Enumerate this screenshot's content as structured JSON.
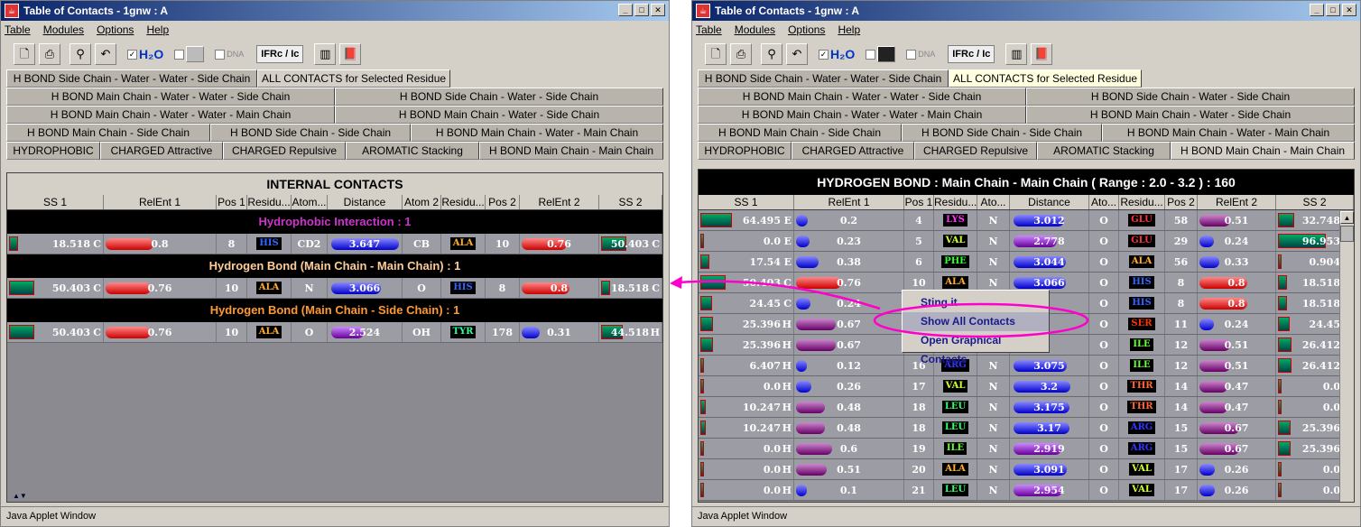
{
  "window_title": "Table of Contacts - 1gnw : A",
  "menu": [
    "Table",
    "Modules",
    "Options",
    "Help"
  ],
  "toolbar": {
    "h2o_label": "H₂O",
    "dna_label": "DNA",
    "ifrc_label": "IFRc / Ic"
  },
  "tabs": {
    "row1": [
      "H BOND Side Chain - Water - Water - Side Chain",
      "ALL CONTACTS for Selected Residue"
    ],
    "row2": [
      "H BOND Main Chain - Water - Water - Side Chain",
      "H BOND Side Chain - Water - Side Chain"
    ],
    "row3": [
      "H BOND Main Chain - Water - Water -  Main Chain",
      "H BOND Main Chain - Water - Side Chain"
    ],
    "row4": [
      "H BOND Main Chain - Side Chain",
      "H BOND Side Chain - Side Chain",
      "H BOND Main Chain - Water - Main Chain"
    ],
    "row5": [
      "HYDROPHOBIC",
      "CHARGED Attractive",
      "CHARGED Repulsive",
      "AROMATIC Stacking",
      "H BOND Main Chain - Main Chain"
    ]
  },
  "columns": [
    "SS 1",
    "RelEnt 1",
    "Pos 1",
    "Residu...",
    "Atom...",
    "Distance",
    "Atom 2",
    "Residu...",
    "Pos 2",
    "RelEnt 2",
    "SS 2"
  ],
  "columns_right": [
    "SS 1",
    "RelEnt 1",
    "Pos 1",
    "Residu...",
    "Ato...",
    "Distance",
    "Ato...",
    "Residu...",
    "Pos 2",
    "RelEnt 2",
    "SS 2"
  ],
  "left": {
    "heading": "INTERNAL CONTACTS",
    "sections": [
      {
        "title": "Hydrophobic Interaction :  1",
        "color": "#cc33cc",
        "rows": [
          {
            "ss1": "18.518",
            "t1": "C",
            "re1": "0.8",
            "p1": "8",
            "r1": "HIS",
            "a1": "CD2",
            "d": "3.647",
            "a2": "CB",
            "r2": "ALA",
            "p2": "10",
            "re2": "0.76",
            "ss2": "50.403",
            "t2": "C"
          }
        ]
      },
      {
        "title": "Hydrogen Bond (Main Chain - Main Chain) :  1",
        "color": "#ffcc99",
        "rows": [
          {
            "ss1": "50.403",
            "t1": "C",
            "re1": "0.76",
            "p1": "10",
            "r1": "ALA",
            "a1": "N",
            "d": "3.066",
            "a2": "O",
            "r2": "HIS",
            "p2": "8",
            "re2": "0.8",
            "ss2": "18.518",
            "t2": "C"
          }
        ]
      },
      {
        "title": "Hydrogen Bond (Main Chain - Side Chain) :  1",
        "color": "#ff9933",
        "rows": [
          {
            "ss1": "50.403",
            "t1": "C",
            "re1": "0.76",
            "p1": "10",
            "r1": "ALA",
            "a1": "O",
            "d": "2.524",
            "a2": "OH",
            "r2": "TYR",
            "p2": "178",
            "re2": "0.31",
            "ss2": "44.518",
            "t2": "H"
          }
        ]
      }
    ]
  },
  "right": {
    "heading": "HYDROGEN BOND : Main Chain - Main Chain ( Range :  2.0 - 3.2 ) :  160",
    "rows": [
      {
        "ss1": "64.495",
        "t1": "E",
        "re1": "0.2",
        "p1": "4",
        "r1": "LYS",
        "a1": "N",
        "d": "3.012",
        "a2": "O",
        "r2": "GLU",
        "p2": "58",
        "re2": "0.51",
        "ss2": "32.748",
        "t2": "E"
      },
      {
        "ss1": "0.0",
        "t1": "E",
        "re1": "0.23",
        "p1": "5",
        "r1": "VAL",
        "a1": "N",
        "d": "2.778",
        "a2": "O",
        "r2": "GLU",
        "p2": "29",
        "re2": "0.24",
        "ss2": "96.953",
        "t2": "E"
      },
      {
        "ss1": "17.54",
        "t1": "E",
        "re1": "0.38",
        "p1": "6",
        "r1": "PHE",
        "a1": "N",
        "d": "3.044",
        "a2": "O",
        "r2": "ALA",
        "p2": "56",
        "re2": "0.33",
        "ss2": "0.904",
        "t2": "E"
      },
      {
        "ss1": "50.403",
        "t1": "C",
        "re1": "0.76",
        "p1": "10",
        "r1": "ALA",
        "a1": "N",
        "d": "3.066",
        "a2": "O",
        "r2": "HIS",
        "p2": "8",
        "re2": "0.8",
        "ss2": "18.518",
        "t2": "C"
      },
      {
        "ss1": "24.45",
        "t1": "C",
        "re1": "0.24",
        "p1": "11",
        "r1": "",
        "a1": "",
        "d": "",
        "a2": "O",
        "r2": "HIS",
        "p2": "8",
        "re2": "0.8",
        "ss2": "18.518",
        "t2": "C"
      },
      {
        "ss1": "25.396",
        "t1": "H",
        "re1": "0.67",
        "p1": "12",
        "r1": "",
        "a1": "",
        "d": "",
        "a2": "O",
        "r2": "SER",
        "p2": "11",
        "re2": "0.24",
        "ss2": "24.45",
        "t2": "C"
      },
      {
        "ss1": "25.396",
        "t1": "H",
        "re1": "0.67",
        "p1": "15",
        "r1": "",
        "a1": "",
        "d": "",
        "a2": "O",
        "r2": "ILE",
        "p2": "12",
        "re2": "0.51",
        "ss2": "26.412",
        "t2": "H"
      },
      {
        "ss1": "6.407",
        "t1": "H",
        "re1": "0.12",
        "p1": "16",
        "r1": "ARG",
        "a1": "N",
        "d": "3.075",
        "a2": "O",
        "r2": "ILE",
        "p2": "12",
        "re2": "0.51",
        "ss2": "26.412",
        "t2": "H"
      },
      {
        "ss1": "0.0",
        "t1": "H",
        "re1": "0.26",
        "p1": "17",
        "r1": "VAL",
        "a1": "N",
        "d": "3.2",
        "a2": "O",
        "r2": "THR",
        "p2": "14",
        "re2": "0.47",
        "ss2": "0.0",
        "t2": "H"
      },
      {
        "ss1": "10.247",
        "t1": "H",
        "re1": "0.48",
        "p1": "18",
        "r1": "LEU",
        "a1": "N",
        "d": "3.175",
        "a2": "O",
        "r2": "THR",
        "p2": "14",
        "re2": "0.47",
        "ss2": "0.0",
        "t2": "H"
      },
      {
        "ss1": "10.247",
        "t1": "H",
        "re1": "0.48",
        "p1": "18",
        "r1": "LEU",
        "a1": "N",
        "d": "3.17",
        "a2": "O",
        "r2": "ARG",
        "p2": "15",
        "re2": "0.67",
        "ss2": "25.396",
        "t2": "H"
      },
      {
        "ss1": "0.0",
        "t1": "H",
        "re1": "0.6",
        "p1": "19",
        "r1": "ILE",
        "a1": "N",
        "d": "2.919",
        "a2": "O",
        "r2": "ARG",
        "p2": "15",
        "re2": "0.67",
        "ss2": "25.396",
        "t2": "H"
      },
      {
        "ss1": "0.0",
        "t1": "H",
        "re1": "0.51",
        "p1": "20",
        "r1": "ALA",
        "a1": "N",
        "d": "3.091",
        "a2": "O",
        "r2": "VAL",
        "p2": "17",
        "re2": "0.26",
        "ss2": "0.0",
        "t2": "H"
      },
      {
        "ss1": "0.0",
        "t1": "H",
        "re1": "0.1",
        "p1": "21",
        "r1": "LEU",
        "a1": "N",
        "d": "2.954",
        "a2": "O",
        "r2": "VAL",
        "p2": "17",
        "re2": "0.26",
        "ss2": "0.0",
        "t2": "H"
      }
    ]
  },
  "popup": [
    "Sting it",
    "Show All Contacts",
    "Open Graphical Contacts"
  ],
  "status": "Java Applet Window",
  "residue_colors": {
    "HIS": "#3366ff",
    "ALA": "#ffaa33",
    "TYR": "#33ff99",
    "LYS": "#ff33ff",
    "VAL": "#ccff33",
    "PHE": "#33ff33",
    "GLU": "#ff3333",
    "ARG": "#3333ff",
    "LEU": "#33ff66",
    "ILE": "#66ff33",
    "THR": "#ff6633",
    "SER": "#ff3300"
  }
}
